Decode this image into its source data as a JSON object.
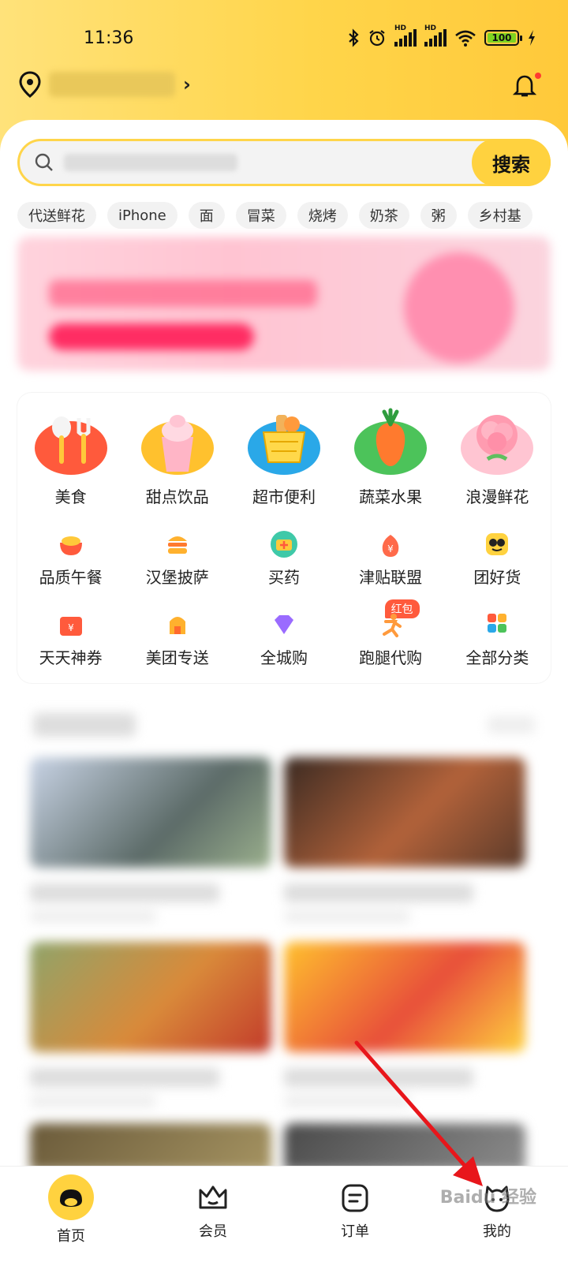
{
  "status": {
    "time": "11:36",
    "hd1": "HD",
    "hd2": "HD",
    "battery": "100"
  },
  "search": {
    "button_label": "搜索"
  },
  "chips": [
    "代送鲜花",
    "iPhone",
    "面",
    "冒菜",
    "烧烤",
    "奶茶",
    "粥",
    "乡村基"
  ],
  "categories_big": [
    {
      "label": "美食",
      "icon": "food-icon",
      "color": "#ff5a3c"
    },
    {
      "label": "甜点饮品",
      "icon": "dessert-icon",
      "color": "#ffc12e"
    },
    {
      "label": "超市便利",
      "icon": "supermarket-icon",
      "color": "#2aa8e8"
    },
    {
      "label": "蔬菜水果",
      "icon": "vegetable-icon",
      "color": "#4cc35a"
    },
    {
      "label": "浪漫鲜花",
      "icon": "flower-icon",
      "color": "#ff9bb0"
    }
  ],
  "categories_row2": [
    {
      "label": "品质午餐",
      "icon": "lunch-icon"
    },
    {
      "label": "汉堡披萨",
      "icon": "burger-icon"
    },
    {
      "label": "买药",
      "icon": "medicine-icon"
    },
    {
      "label": "津贴联盟",
      "icon": "allowance-icon"
    },
    {
      "label": "团好货",
      "icon": "group-goods-icon"
    }
  ],
  "categories_row3": [
    {
      "label": "天天神券",
      "icon": "coupon-icon"
    },
    {
      "label": "美团专送",
      "icon": "delivery-icon"
    },
    {
      "label": "全城购",
      "icon": "citywide-icon"
    },
    {
      "label": "跑腿代购",
      "icon": "errand-icon",
      "badge": "红包"
    },
    {
      "label": "全部分类",
      "icon": "all-categories-icon"
    }
  ],
  "tabs": [
    {
      "label": "首页",
      "icon": "home-icon"
    },
    {
      "label": "会员",
      "icon": "member-icon"
    },
    {
      "label": "订单",
      "icon": "order-icon"
    },
    {
      "label": "我的",
      "icon": "profile-icon"
    }
  ],
  "watermark": "Baidu 经验",
  "colors": {
    "brand": "#ffd23f",
    "annotation_arrow": "#e8161b"
  }
}
